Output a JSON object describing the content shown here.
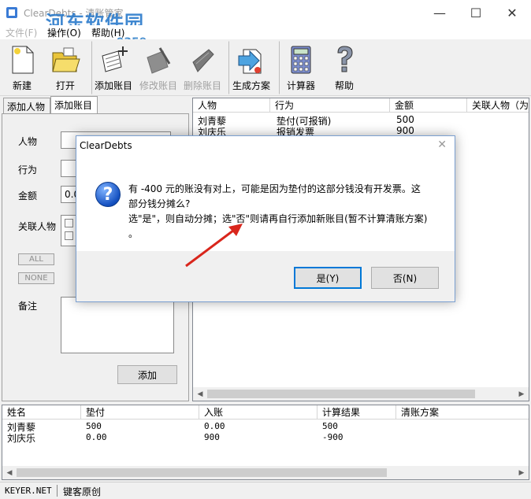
{
  "window": {
    "title": "ClearDebts - 清账管家",
    "watermark": "河东软件园",
    "watermark_url": "www.pc0359.cn",
    "controls": {
      "minimize": "—",
      "maximize": "☐",
      "close": "✕"
    }
  },
  "menu": [
    "文件(F)",
    "操作(O)",
    "帮助(H)"
  ],
  "toolbar": [
    {
      "label": "新建",
      "icon": "new-file-icon",
      "enabled": true
    },
    {
      "label": "打开",
      "icon": "open-folder-icon",
      "enabled": true
    },
    {
      "label": "添加账目",
      "icon": "add-entry-icon",
      "enabled": true
    },
    {
      "label": "修改账目",
      "icon": "edit-entry-icon",
      "enabled": false
    },
    {
      "label": "删除账目",
      "icon": "delete-entry-icon",
      "enabled": false
    },
    {
      "label": "生成方案",
      "icon": "generate-plan-icon",
      "enabled": true
    },
    {
      "label": "计算器",
      "icon": "calculator-icon",
      "enabled": true
    },
    {
      "label": "帮助",
      "icon": "help-icon",
      "enabled": true
    }
  ],
  "left_tabs": [
    "添加人物",
    "添加账目"
  ],
  "form": {
    "person_label": "人物",
    "action_label": "行为",
    "amount_label": "金额",
    "amount_value": "0.0",
    "related_label": "关联人物",
    "all_button": "ALL",
    "none_button": "NONE",
    "note_label": "备注",
    "add_button": "添加"
  },
  "entries": {
    "columns": [
      "人物",
      "行为",
      "金额",
      "关联人物（为"
    ],
    "rows": [
      [
        "刘青藜",
        "垫付(可报销)",
        "500",
        ""
      ],
      [
        "刘庆乐",
        "报销发票",
        "900",
        ""
      ]
    ]
  },
  "summary": {
    "columns": [
      "姓名",
      "垫付",
      "入账",
      "计算结果",
      "清账方案"
    ],
    "rows": [
      [
        "刘青藜",
        "500",
        "0.00",
        "500",
        ""
      ],
      [
        "刘庆乐",
        "0.00",
        "900",
        "-900",
        ""
      ]
    ]
  },
  "status": {
    "left": "KEYER.NET",
    "right": "键客原创"
  },
  "dialog": {
    "title": "ClearDebts",
    "close": "✕",
    "icon": "question-icon",
    "message_lines": [
      "有 -400 元的账没有对上，可能是因为垫付的这部分钱没有开发票。这",
      "部分钱分摊么?",
      "选\"是\"，则自动分摊；选\"否\"则请再自行添加新账目(暂不计算清账方案)",
      "。"
    ],
    "yes": "是(Y)",
    "no": "否(N)"
  },
  "colors": {
    "accent": "#0078d7",
    "annotation_arrow": "#d9261c"
  }
}
